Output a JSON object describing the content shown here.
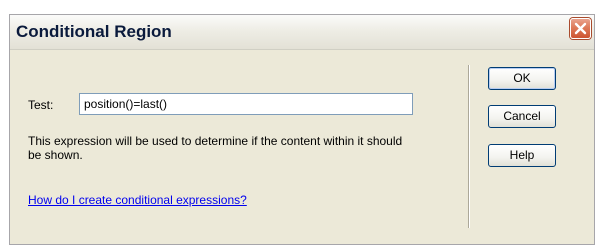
{
  "dialog": {
    "title": "Conditional Region"
  },
  "form": {
    "test_label": "Test:",
    "test_value": "position()=last()",
    "description": "This expression will be used to determine if the content within it should be shown.",
    "help_link": "How do I create conditional expressions?"
  },
  "buttons": {
    "ok": "OK",
    "cancel": "Cancel",
    "help": "Help"
  },
  "icons": {
    "close": "close-icon"
  },
  "colors": {
    "close_button": "#de7a59",
    "link": "#0000ee",
    "dialog_background": "#ece9d8"
  }
}
